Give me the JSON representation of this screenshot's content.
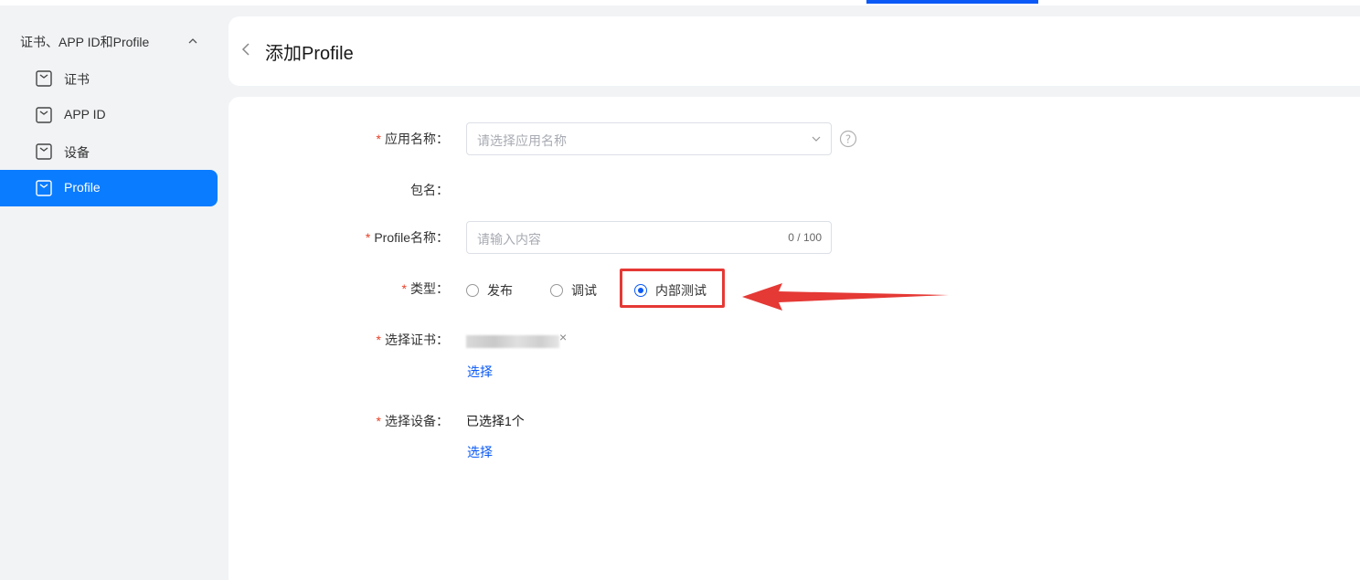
{
  "sidebar": {
    "group_label": "证书、APP ID和Profile",
    "items": [
      {
        "label": "证书",
        "active": false
      },
      {
        "label": "APP ID",
        "active": false
      },
      {
        "label": "设备",
        "active": false
      },
      {
        "label": "Profile",
        "active": true
      }
    ]
  },
  "header": {
    "title": "添加Profile"
  },
  "form": {
    "required_mark": "*",
    "app_name": {
      "label": "应用名称：",
      "placeholder": "请选择应用名称"
    },
    "package": {
      "label": "包名："
    },
    "profile_name": {
      "label": "Profile名称：",
      "placeholder": "请输入内容",
      "counter": "0 / 100"
    },
    "type": {
      "label": "类型：",
      "options": [
        "发布",
        "调试",
        "内部测试"
      ],
      "selected": "内部测试"
    },
    "certificate": {
      "label": "选择证书：",
      "close": "×",
      "select_link": "选择"
    },
    "devices": {
      "label": "选择设备：",
      "value": "已选择1个",
      "select_link": "选择"
    }
  },
  "colors": {
    "accent": "#0a59f7",
    "active_bg": "#0a7cff",
    "required": "#e84026",
    "annotation": "#e53935"
  }
}
